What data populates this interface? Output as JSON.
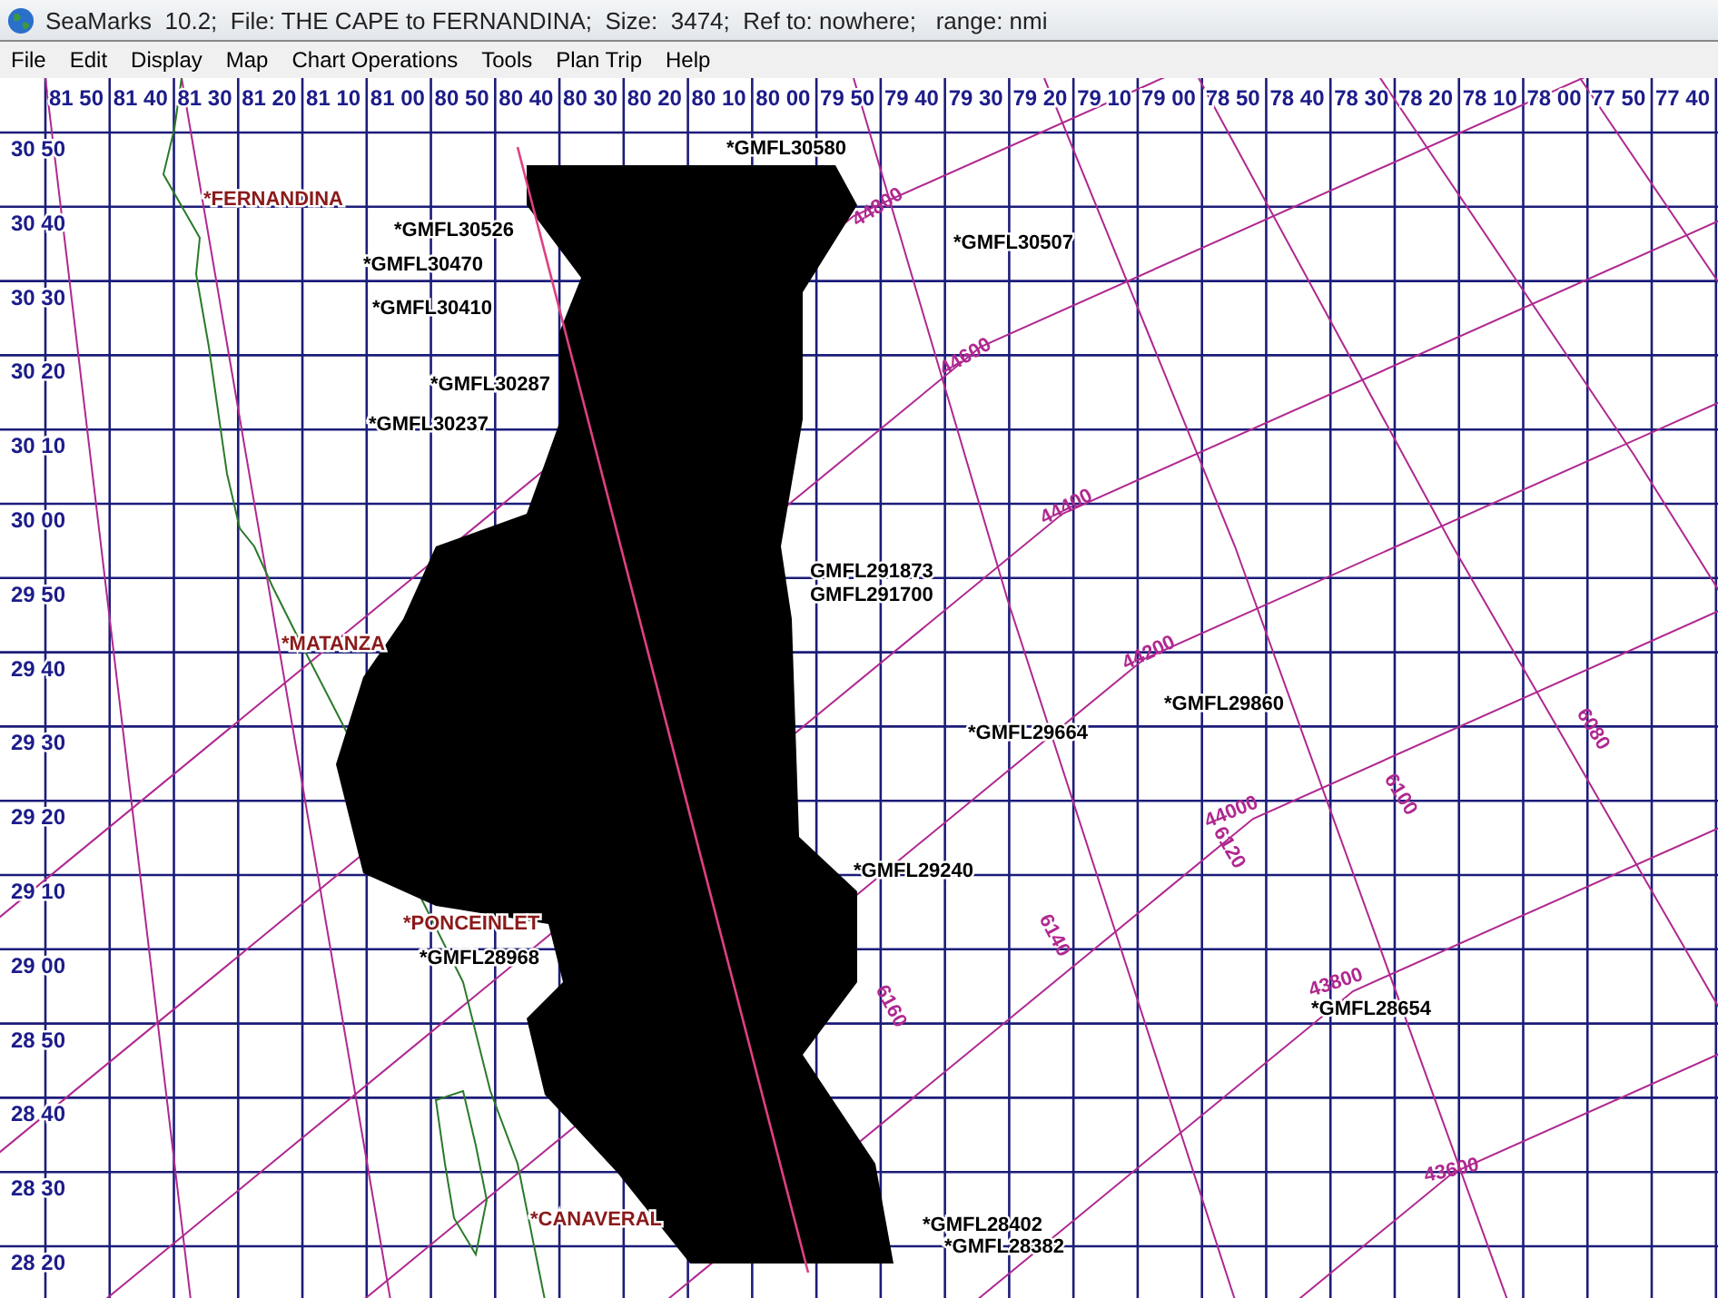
{
  "window": {
    "title": "SeaMarks  10.2;  File: THE CAPE to FERNANDINA;  Size:  3474;  Ref to: nowhere;   range: nmi"
  },
  "menu": [
    "File",
    "Edit",
    "Display",
    "Map",
    "Chart Operations",
    "Tools",
    "Plan Trip",
    "Help"
  ],
  "chart": {
    "longitude_labels": [
      "81 50",
      "81 40",
      "81 30",
      "81 20",
      "81 10",
      "81 00",
      "80 50",
      "80 40",
      "80 30",
      "80 20",
      "80 10",
      "80 00",
      "79 50",
      "79 40",
      "79 30",
      "79 20",
      "79 10",
      "79 00",
      "78 50",
      "78 40",
      "78 30",
      "78 20",
      "78 10",
      "78 00",
      "77 50",
      "77 40"
    ],
    "latitude_labels": [
      "30 50",
      "30 40",
      "30 30",
      "30 20",
      "30 10",
      "30 00",
      "29 50",
      "29 40",
      "29 30",
      "29 20",
      "29 10",
      "29 00",
      "28 50",
      "28 40",
      "28 30",
      "28 20"
    ],
    "marks": [
      {
        "kind": "place",
        "label": "*FERNANDINA"
      },
      {
        "kind": "mark",
        "label": "*GMFL30580"
      },
      {
        "kind": "mark",
        "label": "*GMFL30526"
      },
      {
        "kind": "mark",
        "label": "*GMFL30507"
      },
      {
        "kind": "mark",
        "label": "*GMFL30470"
      },
      {
        "kind": "mark",
        "label": "*GMFL30410"
      },
      {
        "kind": "mark",
        "label": "*GMFL30287"
      },
      {
        "kind": "mark",
        "label": "*GMFL30237"
      },
      {
        "kind": "mark",
        "label": "GMFL291873"
      },
      {
        "kind": "mark",
        "label": "GMFL291700"
      },
      {
        "kind": "place",
        "label": "*MATANZA"
      },
      {
        "kind": "mark",
        "label": "*GMFL29860"
      },
      {
        "kind": "mark",
        "label": "*GMFL29664"
      },
      {
        "kind": "mark",
        "label": "*GMFL29240"
      },
      {
        "kind": "place",
        "label": "*PONCEINLET"
      },
      {
        "kind": "mark",
        "label": "*GMFL28968"
      },
      {
        "kind": "mark",
        "label": "*GMFL28654"
      },
      {
        "kind": "mark",
        "label": "*GMFL28402"
      },
      {
        "kind": "mark",
        "label": "*GMFL28382"
      },
      {
        "kind": "place",
        "label": "*CANAVERAL"
      }
    ],
    "contour_labels": [
      "44800",
      "44600",
      "44400",
      "44200",
      "44000",
      "43800",
      "43600",
      "6080",
      "6100",
      "6120",
      "6140",
      "6160"
    ]
  }
}
